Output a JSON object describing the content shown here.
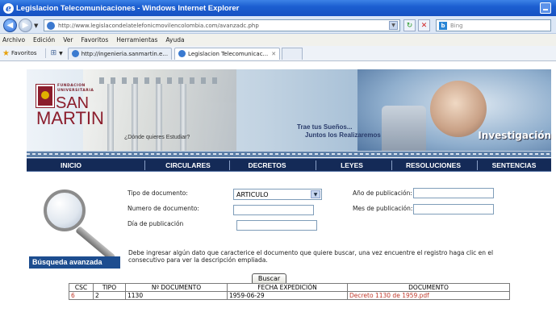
{
  "window": {
    "title": "Legislacion Telecomunicaciones - Windows Internet Explorer"
  },
  "addressbar": {
    "url": "http://www.legislacondelatelefonicmovilencolombia.com/avanzadc.php",
    "search_placeholder": "Bing"
  },
  "menu": {
    "items": [
      "Archivo",
      "Edición",
      "Ver",
      "Favoritos",
      "Herramientas",
      "Ayuda"
    ]
  },
  "favorites": {
    "label": "Favoritos",
    "tabs": [
      {
        "label": "http://ingenieria.sanmartin.e...",
        "active": false
      },
      {
        "label": "Legislacion Telecomunicac...",
        "active": true
      }
    ]
  },
  "banner": {
    "logo_line1": "FUNDACION",
    "logo_line2": "UNIVERSITARIA",
    "logo_san": "SAN",
    "logo_martin": "MARTIN",
    "question": "¿Dónde quieres Estudiar?",
    "slogan_line1": "Trae tus Sueños...",
    "slogan_line2": "Juntos los Realizaremos",
    "section": "Investigación"
  },
  "nav": {
    "items": [
      "INICIO",
      "CIRCULARES",
      "DECRETOS",
      "LEYES",
      "RESOLUCIONES",
      "SENTENCIAS"
    ]
  },
  "form": {
    "tipo_label": "Tipo de documento:",
    "tipo_value": "ARTICULO",
    "numero_label": "Numero de documento:",
    "dia_label": "Día de publicación",
    "anio_label": "Año de publicación:",
    "mes_label": "Mes de publicación:",
    "note": "Debe ingresar algún dato que caracterice el documento que quiere buscar, una vez encuentre el registro haga clic en el consecutivo para ver la descripción empliada.",
    "section_label": "Búsqueda avanzada",
    "search_button": "Buscar"
  },
  "results": {
    "headers": [
      "CSC",
      "TIPO",
      "Nº DOCUMENTO",
      "FECHA EXPEDICIÓN",
      "DOCUMENTO"
    ],
    "rows": [
      {
        "csc": "6",
        "tipo": "2",
        "numero": "1130",
        "fecha": "1959-06-29",
        "documento": "Decreto 1130 de 1959.pdf"
      }
    ]
  },
  "colors": {
    "titlebar": "#1c5fd1",
    "navbar": "#142a57",
    "section_label_bg": "#1d4d8f",
    "link_red": "#c0392b"
  }
}
